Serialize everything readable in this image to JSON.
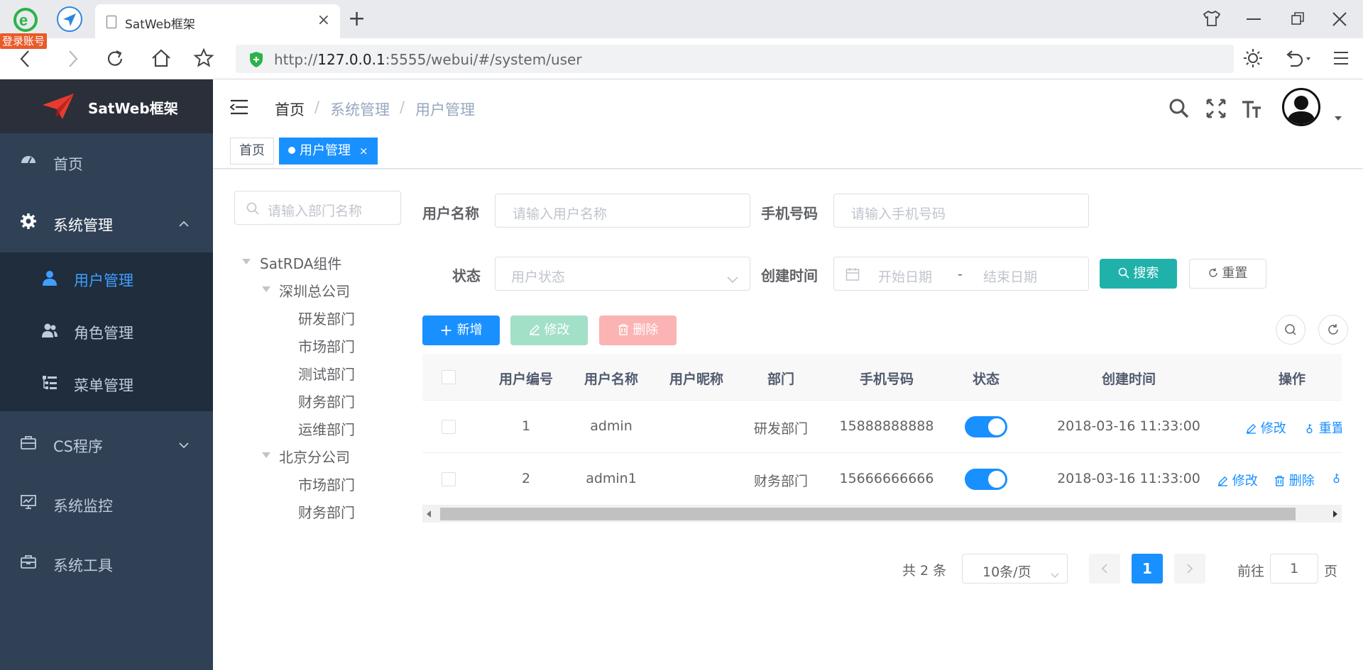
{
  "browser": {
    "login_badge": "登录账号",
    "tab_title": "SatWeb框架",
    "tab_close": "×",
    "new_tab": "+",
    "url_prefix": "http://",
    "url_host": "127.0.0.1",
    "url_rest": ":5555/webui/#/system/user"
  },
  "sidebar": {
    "logo_text": "SatWeb框架",
    "items": [
      {
        "label": "首页",
        "icon": "dashboard-icon"
      },
      {
        "label": "系统管理",
        "icon": "gear-icon"
      },
      {
        "label": "CS程序",
        "icon": "briefcase-icon"
      },
      {
        "label": "系统监控",
        "icon": "monitor-icon"
      },
      {
        "label": "系统工具",
        "icon": "toolbox-icon"
      }
    ],
    "submenu": [
      {
        "label": "用户管理",
        "icon": "user-icon"
      },
      {
        "label": "角色管理",
        "icon": "users-icon"
      },
      {
        "label": "菜单管理",
        "icon": "tree-table-icon"
      }
    ],
    "active_color": "#409eff",
    "bg_color": "#304156"
  },
  "header": {
    "breadcrumb": [
      "首页",
      "系统管理",
      "用户管理"
    ],
    "separator": "/"
  },
  "tags": {
    "home": "首页",
    "active": "用户管理",
    "close": "×"
  },
  "dept_tree": {
    "search_placeholder": "请输入部门名称",
    "root": "SatRDA组件",
    "shenzhen": "深圳总公司",
    "shenzhen_children": [
      "研发部门",
      "市场部门",
      "测试部门",
      "财务部门",
      "运维部门"
    ],
    "beijing": "北京分公司",
    "beijing_children": [
      "市场部门",
      "财务部门"
    ]
  },
  "search_form": {
    "username_label": "用户名称",
    "username_placeholder": "请输入用户名称",
    "phone_label": "手机号码",
    "phone_placeholder": "请输入手机号码",
    "status_label": "状态",
    "status_placeholder": "用户状态",
    "created_label": "创建时间",
    "start_placeholder": "开始日期",
    "range_sep": "-",
    "end_placeholder": "结束日期",
    "search_btn": "搜索",
    "reset_btn": "重置"
  },
  "toolbar": {
    "add": "新增",
    "edit": "修改",
    "delete": "删除"
  },
  "table": {
    "columns": [
      "用户编号",
      "用户名称",
      "用户昵称",
      "部门",
      "手机号码",
      "状态",
      "创建时间",
      "操作"
    ],
    "rows": [
      {
        "id": "1",
        "username": "admin",
        "nickname": "",
        "dept": "研发部门",
        "phone": "15888888888",
        "status": true,
        "created": "2018-03-16 11:33:00",
        "ops": [
          "修改",
          "重置"
        ]
      },
      {
        "id": "2",
        "username": "admin1",
        "nickname": "",
        "dept": "财务部门",
        "phone": "15666666666",
        "status": true,
        "created": "2018-03-16 11:33:00",
        "ops": [
          "修改",
          "删除"
        ]
      }
    ]
  },
  "pagination": {
    "total": "共 2 条",
    "page_size": "10条/页",
    "current": "1",
    "goto_label": "前往",
    "goto_value": "1",
    "page_suffix": "页"
  }
}
